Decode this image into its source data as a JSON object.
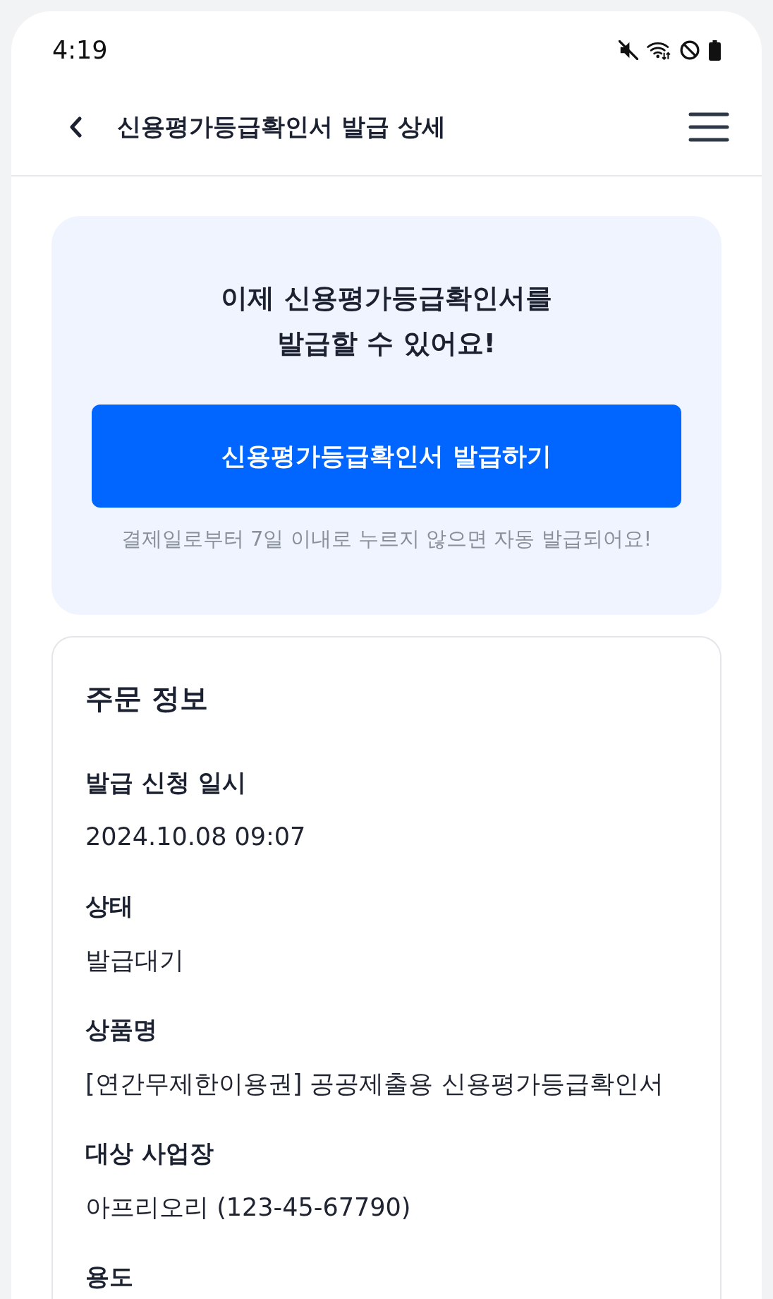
{
  "status_bar": {
    "time": "4:19"
  },
  "header": {
    "title": "신용평가등급확인서 발급 상세"
  },
  "banner": {
    "title": "이제 신용평가등급확인서를 발급할 수 있어요!",
    "button": "신용평가등급확인서 발급하기",
    "notice": "결제일로부터 7일 이내로 누르지 않으면 자동 발급되어요!"
  },
  "order_info": {
    "title": "주문 정보",
    "fields": [
      {
        "label": "발급 신청 일시",
        "value": "2024.10.08 09:07"
      },
      {
        "label": "상태",
        "value": "발급대기"
      },
      {
        "label": "상품명",
        "value": "[연간무제한이용권] 공공제출용 신용평가등급확인서"
      },
      {
        "label": "대상 사업장",
        "value": "아프리오리 (123-45-67790)"
      },
      {
        "label": "용도"
      }
    ]
  }
}
